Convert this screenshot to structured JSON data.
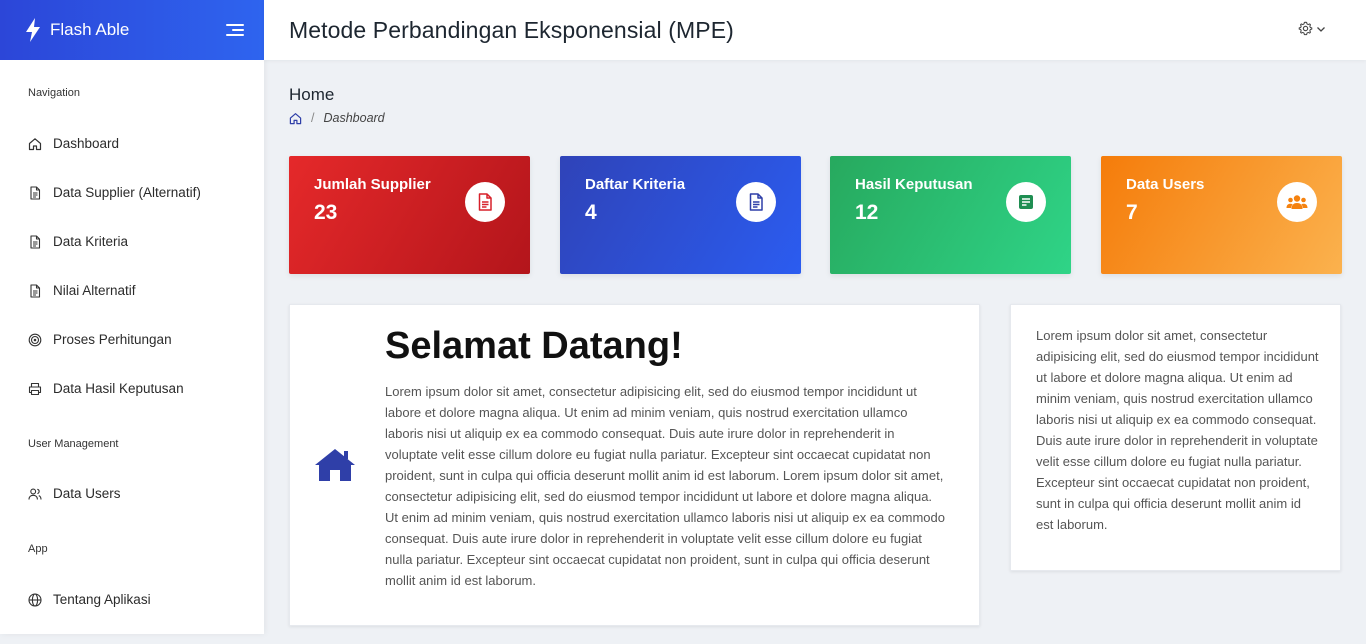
{
  "brand": {
    "name": "Flash Able"
  },
  "header": {
    "title": "Metode Perbandingan Eksponensial (MPE)"
  },
  "sidebar": {
    "captions": {
      "navigation": "Navigation",
      "user_management": "User Management",
      "app": "App"
    },
    "items": [
      {
        "label": "Dashboard",
        "icon": "home-icon"
      },
      {
        "label": "Data Supplier (Alternatif)",
        "icon": "file-icon"
      },
      {
        "label": "Data Kriteria",
        "icon": "file-icon"
      },
      {
        "label": "Nilai Alternatif",
        "icon": "file-icon"
      },
      {
        "label": "Proses Perhitungan",
        "icon": "target-icon"
      },
      {
        "label": "Data Hasil Keputusan",
        "icon": "printer-icon"
      },
      {
        "label": "Data Users",
        "icon": "users-icon"
      },
      {
        "label": "Tentang Aplikasi",
        "icon": "globe-icon"
      }
    ]
  },
  "breadcrumb": {
    "page": "Home",
    "current": "Dashboard",
    "separator": "/"
  },
  "cards": [
    {
      "label": "Jumlah Supplier",
      "value": "23",
      "color": "#d7202a",
      "icon": "file-pdf-icon"
    },
    {
      "label": "Daftar Kriteria",
      "value": "4",
      "color": "#2d50d8",
      "icon": "file-alt-icon"
    },
    {
      "label": "Hasil Keputusan",
      "value": "12",
      "color": "#2cc176",
      "icon": "list-icon"
    },
    {
      "label": "Data Users",
      "value": "7",
      "color": "#f8961f",
      "icon": "users-icon"
    }
  ],
  "welcome": {
    "title": "Selamat Datang!",
    "text": "Lorem ipsum dolor sit amet, consectetur adipisicing elit, sed do eiusmod tempor incididunt ut labore et dolore magna aliqua. Ut enim ad minim veniam, quis nostrud exercitation ullamco laboris nisi ut aliquip ex ea commodo consequat. Duis aute irure dolor in reprehenderit in voluptate velit esse cillum dolore eu fugiat nulla pariatur. Excepteur sint occaecat cupidatat non proident, sunt in culpa qui officia deserunt mollit anim id est laborum. Lorem ipsum dolor sit amet, consectetur adipisicing elit, sed do eiusmod tempor incididunt ut labore et dolore magna aliqua. Ut enim ad minim veniam, quis nostrud exercitation ullamco laboris nisi ut aliquip ex ea commodo consequat. Duis aute irure dolor in reprehenderit in voluptate velit esse cillum dolore eu fugiat nulla pariatur. Excepteur sint occaecat cupidatat non proident, sunt in culpa qui officia deserunt mollit anim id est laborum."
  },
  "side_panel": {
    "text": "Lorem ipsum dolor sit amet, consectetur adipisicing elit, sed do eiusmod tempor incididunt ut labore et dolore magna aliqua. Ut enim ad minim veniam, quis nostrud exercitation ullamco laboris nisi ut aliquip ex ea commodo consequat. Duis aute irure dolor in reprehenderit in voluptate velit esse cillum dolore eu fugiat nulla pariatur. Excepteur sint occaecat cupidatat non proident, sunt in culpa qui officia deserunt mollit anim id est laborum."
  },
  "colors": {
    "accent": "#2e5bef",
    "house_icon": "#2f3fa8",
    "background": "#eef1f5"
  }
}
